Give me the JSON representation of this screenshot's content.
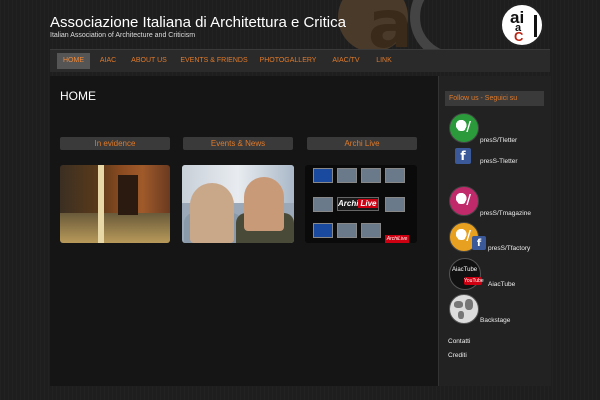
{
  "header": {
    "title": "Associazione Italiana di Architettura e Critica",
    "subtitle": "Italian Association of Architecture and Criticism",
    "logo_text_top": "ai",
    "logo_text_mid": "a",
    "logo_text_bottom": "C",
    "bg_letter": "a"
  },
  "nav": {
    "items": [
      {
        "label": "HOME",
        "active": true
      },
      {
        "label": "AIAC"
      },
      {
        "label": "ABOUT US"
      },
      {
        "label": "EVENTS & FRIENDS"
      },
      {
        "label": "PHOTOGALLERY"
      },
      {
        "label": "AIAC/TV"
      },
      {
        "label": "LINK"
      }
    ]
  },
  "main": {
    "page_title": "HOME",
    "sections": [
      {
        "label": "In evidence"
      },
      {
        "label": "Events & News"
      },
      {
        "label": "Archi Live"
      }
    ],
    "archi_live_logo": "Archi",
    "archi_live_logo_accent": "Live",
    "archi_live_mini": "ArchiLive"
  },
  "sidebar": {
    "follow_header": "Follow us - Seguici su",
    "social": [
      {
        "label": "presS/Tletter",
        "icon": "pressletter-icon"
      },
      {
        "label": "presS-Tletter",
        "icon": "facebook-icon"
      },
      {
        "label": "presS/Tmagazine",
        "icon": "pressmagazine-icon"
      },
      {
        "label": "presS/Tfactory",
        "icon": "pressfactory-icon"
      },
      {
        "label": "AiacTube",
        "icon": "aiactube-icon"
      },
      {
        "label": "Backstage",
        "icon": "globe-icon"
      }
    ],
    "sp_letter": "S/",
    "fb_letter": "f",
    "aiactube_top": "AiacTube",
    "aiactube_yt": "YouTube",
    "links": [
      {
        "label": "Contatti"
      },
      {
        "label": "Crediti"
      }
    ]
  },
  "colors": {
    "accent": "#e07a2a",
    "background": "#1e1e1e",
    "nav_background": "#2a2a2a",
    "active_tab": "#555555"
  }
}
